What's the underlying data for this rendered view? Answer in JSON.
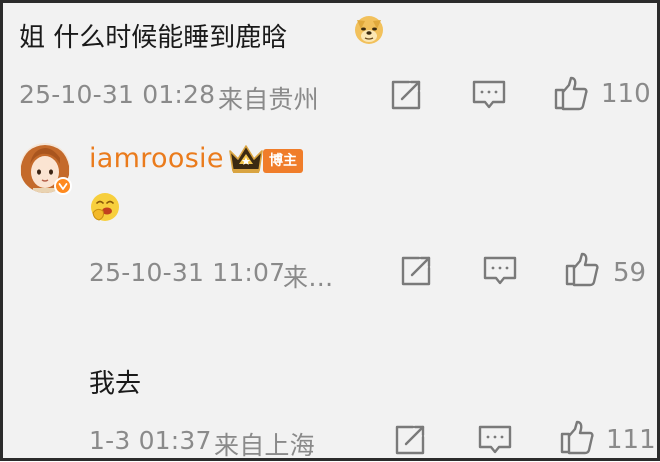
{
  "comment1": {
    "text": "姐 什么时候能睡到鹿晗",
    "emoji_icon": "doge-emoji-icon",
    "timestamp": "25-10-31 01:28",
    "location": "来自贵州",
    "likes": "110"
  },
  "reply": {
    "username": "iamroosie",
    "badge": "博主",
    "emoji_icon": "shy-laugh-emoji-icon",
    "timestamp": "25-10-31 11:07",
    "location": "来…",
    "likes": "59"
  },
  "comment2": {
    "text": "我去",
    "timestamp": "1-3 01:37",
    "location": "来自上海",
    "likes": "111"
  },
  "colors": {
    "background": "#f2f2f2",
    "username": "#ea7b1c",
    "badge": "#f07d2a",
    "meta_text": "#8a8a8a",
    "icon_stroke": "#7a7a7a"
  }
}
